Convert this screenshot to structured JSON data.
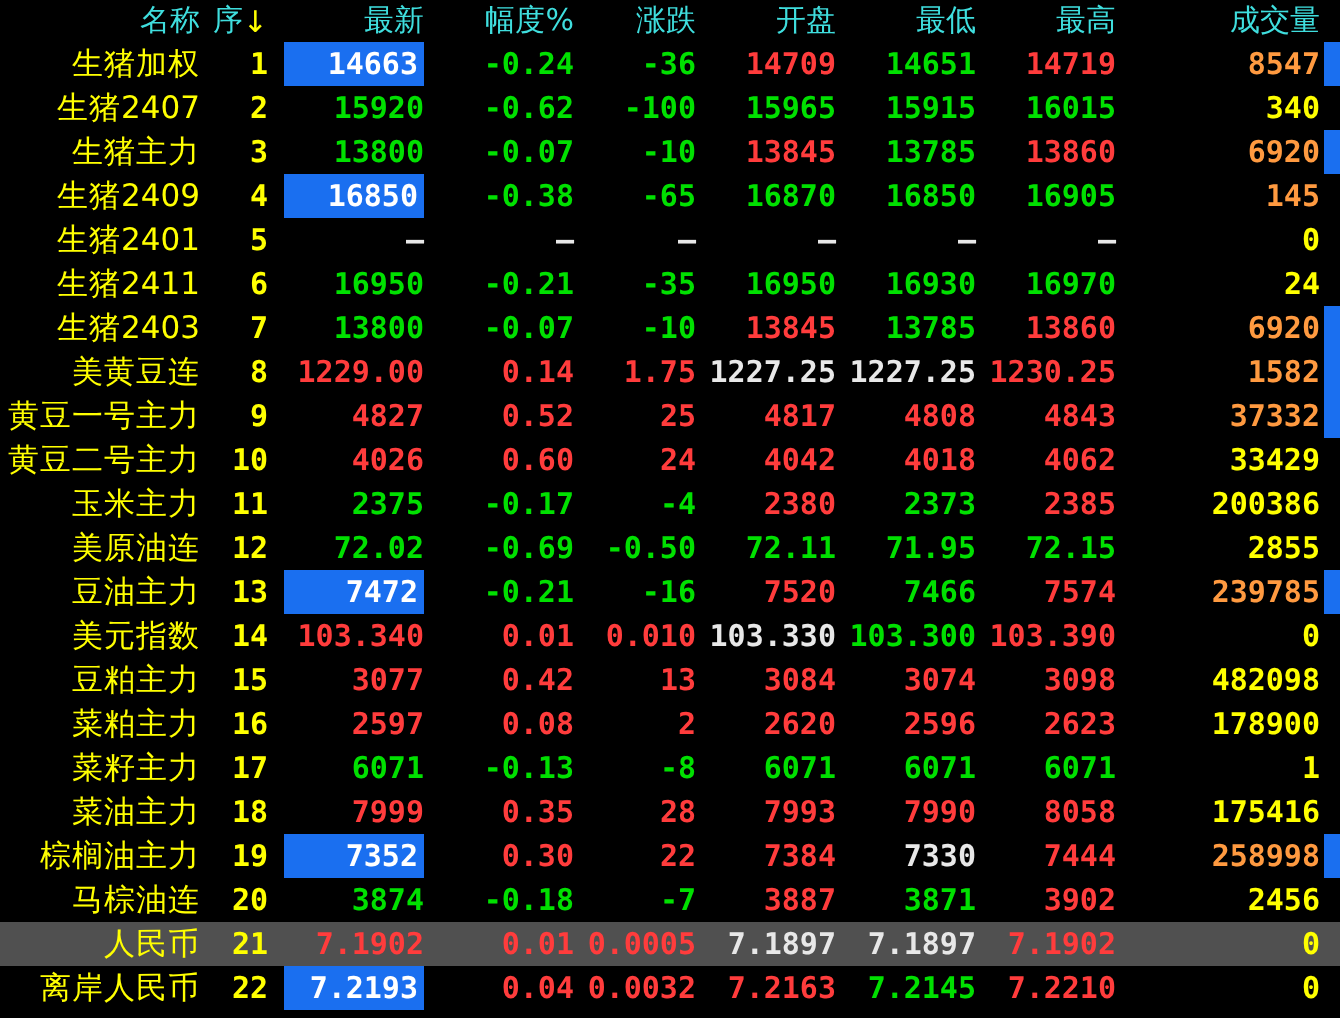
{
  "columns": [
    {
      "label": "名称"
    },
    {
      "label": "序",
      "sort_indicator": "↓"
    },
    {
      "label": "最新"
    },
    {
      "label": "幅度%"
    },
    {
      "label": "涨跌"
    },
    {
      "label": "开盘"
    },
    {
      "label": "最低"
    },
    {
      "label": "最高"
    },
    {
      "label": "成交量"
    }
  ],
  "rows": [
    {
      "name": "生猪加权",
      "seq": "1",
      "selected": false,
      "marker": true,
      "highlight_last": true,
      "cells": [
        {
          "text": "14663"
        },
        {
          "text": "-0.24",
          "color": "#00e000"
        },
        {
          "text": "-36",
          "color": "#00e000"
        },
        {
          "text": "14709",
          "color": "#ff3c3c"
        },
        {
          "text": "14651",
          "color": "#00e000"
        },
        {
          "text": "14719",
          "color": "#ff3c3c"
        },
        {
          "text": "8547",
          "color": "#ff9a40"
        }
      ]
    },
    {
      "name": "生猪2407",
      "seq": "2",
      "selected": false,
      "marker": false,
      "highlight_last": false,
      "cells": [
        {
          "text": "15920",
          "color": "#00e000"
        },
        {
          "text": "-0.62",
          "color": "#00e000"
        },
        {
          "text": "-100",
          "color": "#00e000"
        },
        {
          "text": "15965",
          "color": "#00e000"
        },
        {
          "text": "15915",
          "color": "#00e000"
        },
        {
          "text": "16015",
          "color": "#00e000"
        },
        {
          "text": "340",
          "color": "#ffff00"
        }
      ]
    },
    {
      "name": "生猪主力",
      "seq": "3",
      "selected": false,
      "marker": true,
      "highlight_last": false,
      "cells": [
        {
          "text": "13800",
          "color": "#00e000"
        },
        {
          "text": "-0.07",
          "color": "#00e000"
        },
        {
          "text": "-10",
          "color": "#00e000"
        },
        {
          "text": "13845",
          "color": "#ff3c3c"
        },
        {
          "text": "13785",
          "color": "#00e000"
        },
        {
          "text": "13860",
          "color": "#ff3c3c"
        },
        {
          "text": "6920",
          "color": "#ff9a40"
        }
      ]
    },
    {
      "name": "生猪2409",
      "seq": "4",
      "selected": false,
      "marker": false,
      "highlight_last": true,
      "cells": [
        {
          "text": "16850"
        },
        {
          "text": "-0.38",
          "color": "#00e000"
        },
        {
          "text": "-65",
          "color": "#00e000"
        },
        {
          "text": "16870",
          "color": "#00e000"
        },
        {
          "text": "16850",
          "color": "#00e000"
        },
        {
          "text": "16905",
          "color": "#00e000"
        },
        {
          "text": "145",
          "color": "#ff9a40"
        }
      ]
    },
    {
      "name": "生猪2401",
      "seq": "5",
      "selected": false,
      "marker": false,
      "highlight_last": false,
      "cells": [
        {
          "text": "—",
          "color": "#e8e8e8"
        },
        {
          "text": "—",
          "color": "#e8e8e8"
        },
        {
          "text": "—",
          "color": "#e8e8e8"
        },
        {
          "text": "—",
          "color": "#e8e8e8"
        },
        {
          "text": "—",
          "color": "#e8e8e8"
        },
        {
          "text": "—",
          "color": "#e8e8e8"
        },
        {
          "text": "0",
          "color": "#ffff00"
        }
      ]
    },
    {
      "name": "生猪2411",
      "seq": "6",
      "selected": false,
      "marker": false,
      "highlight_last": false,
      "cells": [
        {
          "text": "16950",
          "color": "#00e000"
        },
        {
          "text": "-0.21",
          "color": "#00e000"
        },
        {
          "text": "-35",
          "color": "#00e000"
        },
        {
          "text": "16950",
          "color": "#00e000"
        },
        {
          "text": "16930",
          "color": "#00e000"
        },
        {
          "text": "16970",
          "color": "#00e000"
        },
        {
          "text": "24",
          "color": "#ffff00"
        }
      ]
    },
    {
      "name": "生猪2403",
      "seq": "7",
      "selected": false,
      "marker": true,
      "highlight_last": false,
      "cells": [
        {
          "text": "13800",
          "color": "#00e000"
        },
        {
          "text": "-0.07",
          "color": "#00e000"
        },
        {
          "text": "-10",
          "color": "#00e000"
        },
        {
          "text": "13845",
          "color": "#ff3c3c"
        },
        {
          "text": "13785",
          "color": "#00e000"
        },
        {
          "text": "13860",
          "color": "#ff3c3c"
        },
        {
          "text": "6920",
          "color": "#ff9a40"
        }
      ]
    },
    {
      "name": "美黄豆连",
      "seq": "8",
      "selected": false,
      "marker": true,
      "highlight_last": false,
      "cells": [
        {
          "text": "1229.00",
          "color": "#ff3c3c"
        },
        {
          "text": "0.14",
          "color": "#ff3c3c"
        },
        {
          "text": "1.75",
          "color": "#ff3c3c"
        },
        {
          "text": "1227.25",
          "color": "#e8e8e8"
        },
        {
          "text": "1227.25",
          "color": "#e8e8e8"
        },
        {
          "text": "1230.25",
          "color": "#ff3c3c"
        },
        {
          "text": "1582",
          "color": "#ff9a40"
        }
      ]
    },
    {
      "name": "黄豆一号主力",
      "seq": "9",
      "selected": false,
      "marker": true,
      "highlight_last": false,
      "cells": [
        {
          "text": "4827",
          "color": "#ff3c3c"
        },
        {
          "text": "0.52",
          "color": "#ff3c3c"
        },
        {
          "text": "25",
          "color": "#ff3c3c"
        },
        {
          "text": "4817",
          "color": "#ff3c3c"
        },
        {
          "text": "4808",
          "color": "#ff3c3c"
        },
        {
          "text": "4843",
          "color": "#ff3c3c"
        },
        {
          "text": "37332",
          "color": "#ff9a40"
        }
      ]
    },
    {
      "name": "黄豆二号主力",
      "seq": "10",
      "selected": false,
      "marker": false,
      "highlight_last": false,
      "cells": [
        {
          "text": "4026",
          "color": "#ff3c3c"
        },
        {
          "text": "0.60",
          "color": "#ff3c3c"
        },
        {
          "text": "24",
          "color": "#ff3c3c"
        },
        {
          "text": "4042",
          "color": "#ff3c3c"
        },
        {
          "text": "4018",
          "color": "#ff3c3c"
        },
        {
          "text": "4062",
          "color": "#ff3c3c"
        },
        {
          "text": "33429",
          "color": "#ffff00"
        }
      ]
    },
    {
      "name": "玉米主力",
      "seq": "11",
      "selected": false,
      "marker": false,
      "highlight_last": false,
      "cells": [
        {
          "text": "2375",
          "color": "#00e000"
        },
        {
          "text": "-0.17",
          "color": "#00e000"
        },
        {
          "text": "-4",
          "color": "#00e000"
        },
        {
          "text": "2380",
          "color": "#ff3c3c"
        },
        {
          "text": "2373",
          "color": "#00e000"
        },
        {
          "text": "2385",
          "color": "#ff3c3c"
        },
        {
          "text": "200386",
          "color": "#ffff00"
        }
      ]
    },
    {
      "name": "美原油连",
      "seq": "12",
      "selected": false,
      "marker": false,
      "highlight_last": false,
      "cells": [
        {
          "text": "72.02",
          "color": "#00e000"
        },
        {
          "text": "-0.69",
          "color": "#00e000"
        },
        {
          "text": "-0.50",
          "color": "#00e000"
        },
        {
          "text": "72.11",
          "color": "#00e000"
        },
        {
          "text": "71.95",
          "color": "#00e000"
        },
        {
          "text": "72.15",
          "color": "#00e000"
        },
        {
          "text": "2855",
          "color": "#ffff00"
        }
      ]
    },
    {
      "name": "豆油主力",
      "seq": "13",
      "selected": false,
      "marker": true,
      "highlight_last": true,
      "cells": [
        {
          "text": "7472"
        },
        {
          "text": "-0.21",
          "color": "#00e000"
        },
        {
          "text": "-16",
          "color": "#00e000"
        },
        {
          "text": "7520",
          "color": "#ff3c3c"
        },
        {
          "text": "7466",
          "color": "#00e000"
        },
        {
          "text": "7574",
          "color": "#ff3c3c"
        },
        {
          "text": "239785",
          "color": "#ff9a40"
        }
      ]
    },
    {
      "name": "美元指数",
      "seq": "14",
      "selected": false,
      "marker": false,
      "highlight_last": false,
      "cells": [
        {
          "text": "103.340",
          "color": "#ff3c3c"
        },
        {
          "text": "0.01",
          "color": "#ff3c3c"
        },
        {
          "text": "0.010",
          "color": "#ff3c3c"
        },
        {
          "text": "103.330",
          "color": "#e8e8e8"
        },
        {
          "text": "103.300",
          "color": "#00e000"
        },
        {
          "text": "103.390",
          "color": "#ff3c3c"
        },
        {
          "text": "0",
          "color": "#ffff00"
        }
      ]
    },
    {
      "name": "豆粕主力",
      "seq": "15",
      "selected": false,
      "marker": false,
      "highlight_last": false,
      "cells": [
        {
          "text": "3077",
          "color": "#ff3c3c"
        },
        {
          "text": "0.42",
          "color": "#ff3c3c"
        },
        {
          "text": "13",
          "color": "#ff3c3c"
        },
        {
          "text": "3084",
          "color": "#ff3c3c"
        },
        {
          "text": "3074",
          "color": "#ff3c3c"
        },
        {
          "text": "3098",
          "color": "#ff3c3c"
        },
        {
          "text": "482098",
          "color": "#ffff00"
        }
      ]
    },
    {
      "name": "菜粕主力",
      "seq": "16",
      "selected": false,
      "marker": false,
      "highlight_last": false,
      "cells": [
        {
          "text": "2597",
          "color": "#ff3c3c"
        },
        {
          "text": "0.08",
          "color": "#ff3c3c"
        },
        {
          "text": "2",
          "color": "#ff3c3c"
        },
        {
          "text": "2620",
          "color": "#ff3c3c"
        },
        {
          "text": "2596",
          "color": "#ff3c3c"
        },
        {
          "text": "2623",
          "color": "#ff3c3c"
        },
        {
          "text": "178900",
          "color": "#ffff00"
        }
      ]
    },
    {
      "name": "菜籽主力",
      "seq": "17",
      "selected": false,
      "marker": false,
      "highlight_last": false,
      "cells": [
        {
          "text": "6071",
          "color": "#00e000"
        },
        {
          "text": "-0.13",
          "color": "#00e000"
        },
        {
          "text": "-8",
          "color": "#00e000"
        },
        {
          "text": "6071",
          "color": "#00e000"
        },
        {
          "text": "6071",
          "color": "#00e000"
        },
        {
          "text": "6071",
          "color": "#00e000"
        },
        {
          "text": "1",
          "color": "#ffff00"
        }
      ]
    },
    {
      "name": "菜油主力",
      "seq": "18",
      "selected": false,
      "marker": false,
      "highlight_last": false,
      "cells": [
        {
          "text": "7999",
          "color": "#ff3c3c"
        },
        {
          "text": "0.35",
          "color": "#ff3c3c"
        },
        {
          "text": "28",
          "color": "#ff3c3c"
        },
        {
          "text": "7993",
          "color": "#ff3c3c"
        },
        {
          "text": "7990",
          "color": "#ff3c3c"
        },
        {
          "text": "8058",
          "color": "#ff3c3c"
        },
        {
          "text": "175416",
          "color": "#ffff00"
        }
      ]
    },
    {
      "name": "棕榈油主力",
      "seq": "19",
      "selected": false,
      "marker": true,
      "highlight_last": true,
      "cells": [
        {
          "text": "7352"
        },
        {
          "text": "0.30",
          "color": "#ff3c3c"
        },
        {
          "text": "22",
          "color": "#ff3c3c"
        },
        {
          "text": "7384",
          "color": "#ff3c3c"
        },
        {
          "text": "7330",
          "color": "#e8e8e8"
        },
        {
          "text": "7444",
          "color": "#ff3c3c"
        },
        {
          "text": "258998",
          "color": "#ff9a40"
        }
      ]
    },
    {
      "name": "马棕油连",
      "seq": "20",
      "selected": false,
      "marker": false,
      "highlight_last": false,
      "cells": [
        {
          "text": "3874",
          "color": "#00e000"
        },
        {
          "text": "-0.18",
          "color": "#00e000"
        },
        {
          "text": "-7",
          "color": "#00e000"
        },
        {
          "text": "3887",
          "color": "#ff3c3c"
        },
        {
          "text": "3871",
          "color": "#00e000"
        },
        {
          "text": "3902",
          "color": "#ff3c3c"
        },
        {
          "text": "2456",
          "color": "#ffff00"
        }
      ]
    },
    {
      "name": "人民币",
      "seq": "21",
      "selected": true,
      "marker": false,
      "highlight_last": false,
      "cells": [
        {
          "text": "7.1902",
          "color": "#ff3c3c"
        },
        {
          "text": "0.01",
          "color": "#ff3c3c"
        },
        {
          "text": "0.0005",
          "color": "#ff3c3c"
        },
        {
          "text": "7.1897",
          "color": "#e8e8e8"
        },
        {
          "text": "7.1897",
          "color": "#e8e8e8"
        },
        {
          "text": "7.1902",
          "color": "#ff3c3c"
        },
        {
          "text": "0",
          "color": "#ffff00"
        }
      ]
    },
    {
      "name": "离岸人民币",
      "seq": "22",
      "selected": false,
      "marker": false,
      "highlight_last": true,
      "cells": [
        {
          "text": "7.2193"
        },
        {
          "text": "0.04",
          "color": "#ff3c3c"
        },
        {
          "text": "0.0032",
          "color": "#ff3c3c"
        },
        {
          "text": "7.2163",
          "color": "#ff3c3c"
        },
        {
          "text": "7.2145",
          "color": "#00e000"
        },
        {
          "text": "7.2210",
          "color": "#ff3c3c"
        },
        {
          "text": "0",
          "color": "#ffff00"
        }
      ]
    }
  ]
}
